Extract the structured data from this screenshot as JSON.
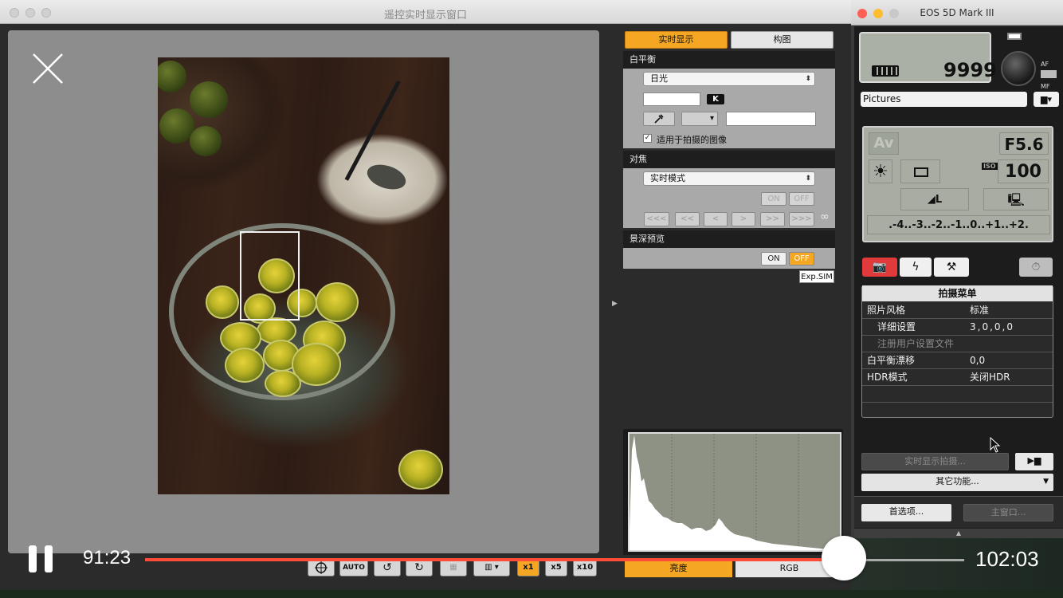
{
  "liveview_window": {
    "title": "遥控实时显示窗口"
  },
  "panel": {
    "tabs": [
      {
        "label": "实时显示",
        "active": true
      },
      {
        "label": "构图",
        "active": false
      }
    ],
    "white_balance": {
      "heading": "白平衡",
      "mode": "日光",
      "k_label": "K",
      "apply_checkbox_label": "适用于拍摄的图像",
      "apply_checked": true
    },
    "focus": {
      "heading": "对焦",
      "mode": "实时模式",
      "on_label": "ON",
      "off_label": "OFF",
      "nav_buttons": [
        "<<<",
        "<<",
        "<",
        ">",
        ">>",
        ">>>"
      ],
      "infinity": "∞"
    },
    "dof_preview": {
      "heading": "景深预览",
      "on_label": "ON",
      "off_label": "OFF",
      "off_active": true,
      "expsim_label": "Exp.SIM"
    },
    "histogram_tabs": [
      {
        "label": "亮度",
        "active": true
      },
      {
        "label": "RGB",
        "active": false
      }
    ]
  },
  "toolbar": {
    "auto_label": "AUTO",
    "zoom_x1": "x1",
    "zoom_x5": "x5",
    "zoom_x10": "x10"
  },
  "camera": {
    "title": "EOS 5D Mark III",
    "shots_remaining": "9999",
    "af_label": "AF",
    "mf_label": "MF",
    "save_folder": "Pictures",
    "mode": "Av",
    "aperture": "F5.6",
    "iso_label": "ISO",
    "iso": "100",
    "exposure_scale": ".-4..-3..-2..-1..0..+1..+2.",
    "menu": {
      "heading": "拍摄菜单",
      "rows": [
        {
          "key": "照片风格",
          "value": "标准"
        },
        {
          "key": "详细设置",
          "value": "3,0,0,0"
        },
        {
          "key": "注册用户设置文件",
          "value": ""
        },
        {
          "key": "白平衡漂移",
          "value": "0,0"
        },
        {
          "key": "HDR模式",
          "value": "关闭HDR"
        }
      ]
    },
    "live_shoot_button": "实时显示拍摄...",
    "other_functions": "其它功能...",
    "preferences": "首选项...",
    "main_window": "主窗口..."
  },
  "video": {
    "elapsed": "91:23",
    "total": "102:03",
    "progress": 0.853
  },
  "colors": {
    "accent": "#f5a623",
    "progress": "#ff4d3a",
    "shoot_tab": "#e03a3a"
  }
}
